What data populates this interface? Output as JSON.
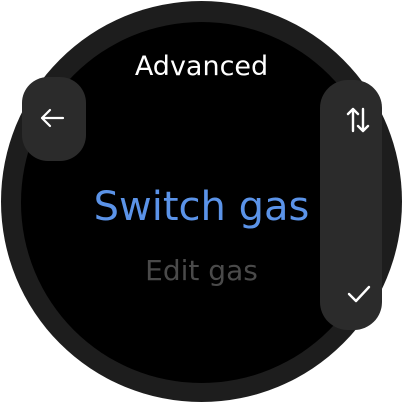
{
  "header": {
    "title": "Advanced",
    "back_icon": "arrow-left-icon"
  },
  "side_bar": {
    "scroll_icon": "sort-arrows-icon",
    "confirm_icon": "check-icon"
  },
  "menu": {
    "options": [
      {
        "label": "Switch gas",
        "state": "selected"
      },
      {
        "label": "Edit gas",
        "state": "unselected"
      }
    ]
  },
  "colors": {
    "selected": "#5b93e8",
    "unselected": "#4a4a4a",
    "button_bg": "#2b2b2b",
    "bezel": "#1d1d1d",
    "screen": "#000000"
  }
}
